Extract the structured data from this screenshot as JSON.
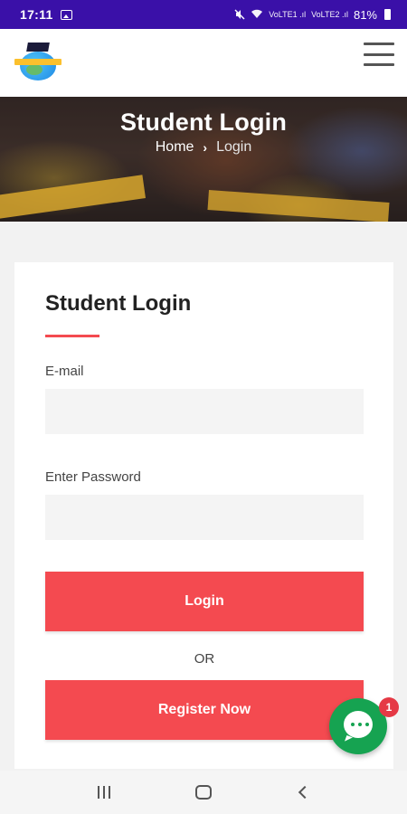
{
  "status_bar": {
    "time": "17:11",
    "signal_1": "VoLTE1 .ıl",
    "signal_2": "VoLTE2 .ıl",
    "battery": "81%"
  },
  "header": {
    "logo_name": "graduation-globe-logo",
    "menu_icon": "hamburger-icon"
  },
  "hero": {
    "title": "Student Login",
    "breadcrumb": {
      "home": "Home",
      "separator": "›",
      "current": "Login"
    }
  },
  "form": {
    "title": "Student Login",
    "email_label": "E-mail",
    "email_value": "",
    "password_label": "Enter Password",
    "password_value": "",
    "login_button": "Login",
    "or_text": "OR",
    "register_button": "Register Now"
  },
  "chat": {
    "badge_count": "1"
  },
  "colors": {
    "status_bar": "#3a10a8",
    "accent": "#f44a50",
    "chat_green": "#16a351"
  }
}
